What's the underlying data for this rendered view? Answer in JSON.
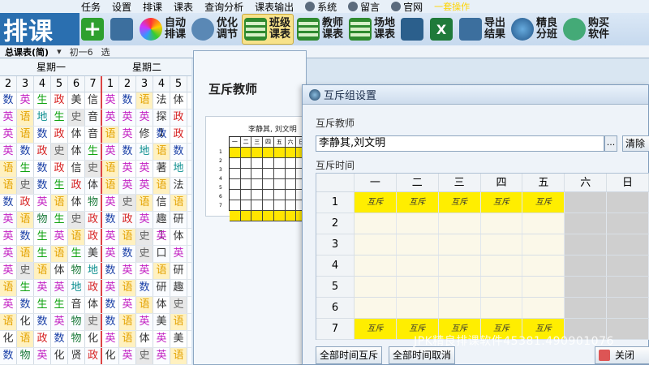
{
  "app": {
    "brand": "排课",
    "menu": [
      "任务",
      "设置",
      "排课",
      "课表",
      "查询分析",
      "课表输出"
    ],
    "menu_extra": [
      "系统",
      "留言",
      "官网"
    ],
    "menu_highlight": "一套操作"
  },
  "toolbar": [
    {
      "icon": "plus-icon",
      "label": ""
    },
    {
      "icon": "import-icon",
      "label": ""
    },
    {
      "icon": "auto-schedule-icon",
      "label": "自动排课"
    },
    {
      "icon": "optimize-icon",
      "label": "优化调节"
    },
    {
      "icon": "class-table-icon",
      "label": "班级课表",
      "active": true
    },
    {
      "icon": "teacher-table-icon",
      "label": "教师课表"
    },
    {
      "icon": "venue-table-icon",
      "label": "场地课表"
    },
    {
      "icon": "save-icon",
      "label": ""
    },
    {
      "icon": "excel-icon",
      "label": ""
    },
    {
      "icon": "export-icon",
      "label": "导出结果"
    },
    {
      "icon": "globe-icon",
      "label": "精良分班"
    },
    {
      "icon": "buy-icon",
      "label": "购买软件"
    }
  ],
  "subbar": {
    "view": "总课表(简)",
    "term": "初一6",
    "option": "选"
  },
  "grid": {
    "days": [
      "星期一",
      "星期二"
    ],
    "periods": [
      "2",
      "3",
      "4",
      "5",
      "6",
      "7",
      "1",
      "2",
      "3",
      "4",
      "5"
    ],
    "rows": [
      [
        "数",
        "英",
        "生",
        "政",
        "美",
        "信",
        "英",
        "数",
        "语",
        "法",
        "体"
      ],
      [
        "英",
        "语",
        "地",
        "生",
        "史",
        "音",
        "英",
        "英",
        "英",
        "探1",
        "政"
      ],
      [
        "英",
        "语",
        "数",
        "政",
        "体",
        "音",
        "语",
        "英",
        "修",
        "数",
        "政"
      ],
      [
        "英",
        "数",
        "政",
        "史",
        "体",
        "生",
        "英",
        "数",
        "地",
        "语",
        "数"
      ],
      [
        "语",
        "生",
        "数",
        "政",
        "信",
        "史",
        "语",
        "英",
        "英",
        "著",
        "地"
      ],
      [
        "语",
        "史",
        "数",
        "生",
        "政",
        "体",
        "语",
        "英",
        "英",
        "语",
        "法"
      ],
      [
        "数",
        "政",
        "英",
        "语",
        "体",
        "物",
        "英",
        "史",
        "语",
        "信",
        "语"
      ],
      [
        "英",
        "语",
        "物",
        "生",
        "史",
        "政",
        "数",
        "政",
        "英",
        "趣1",
        "研"
      ],
      [
        "英",
        "数",
        "生",
        "英",
        "语",
        "政",
        "英",
        "语",
        "史",
        "英",
        "体"
      ],
      [
        "英",
        "语",
        "生",
        "语",
        "生",
        "美",
        "英",
        "数",
        "史",
        "口1",
        "英"
      ],
      [
        "英",
        "史",
        "语",
        "体",
        "物",
        "地",
        "数",
        "英",
        "英",
        "语",
        "研"
      ],
      [
        "语",
        "生",
        "英",
        "英",
        "地",
        "政",
        "英",
        "语",
        "数",
        "研",
        "趣1"
      ],
      [
        "英",
        "数",
        "生",
        "生",
        "音",
        "体",
        "数",
        "英",
        "语",
        "体",
        "史"
      ],
      [
        "语",
        "化",
        "数",
        "英",
        "物",
        "史",
        "数",
        "语",
        "英",
        "美",
        "语"
      ],
      [
        "化",
        "语",
        "政",
        "数",
        "物",
        "化",
        "英",
        "语",
        "体",
        "英",
        "美"
      ],
      [
        "数",
        "物",
        "英",
        "化",
        "贤",
        "政",
        "化",
        "英",
        "史",
        "英",
        "语"
      ]
    ]
  },
  "mid": {
    "title": "互斥教师",
    "mini_name": "李静其, 刘文明",
    "mini_cols": [
      "一",
      "二",
      "三",
      "四",
      "五",
      "六",
      "日"
    ],
    "mini_rows": [
      "1",
      "2",
      "3",
      "4",
      "5",
      "6",
      "7"
    ]
  },
  "dialog": {
    "title": "互斥组设置",
    "teacher_label": "互斥教师",
    "teacher_value": "李静其,刘文明",
    "ellipsis": "...",
    "clear": "清除",
    "time_label": "互斥时间",
    "days": [
      "一",
      "二",
      "三",
      "四",
      "五",
      "六",
      "日"
    ],
    "mark": "互斥",
    "rows": [
      {
        "num": "1",
        "slots": [
          true,
          true,
          true,
          true,
          true,
          false,
          false
        ]
      },
      {
        "num": "2",
        "slots": [
          false,
          false,
          false,
          false,
          false,
          false,
          false
        ]
      },
      {
        "num": "3",
        "slots": [
          false,
          false,
          false,
          false,
          false,
          false,
          false
        ]
      },
      {
        "num": "4",
        "slots": [
          false,
          false,
          false,
          false,
          false,
          false,
          false
        ]
      },
      {
        "num": "5",
        "slots": [
          false,
          false,
          false,
          false,
          false,
          false,
          false
        ]
      },
      {
        "num": "6",
        "slots": [
          false,
          false,
          false,
          false,
          false,
          false,
          false
        ]
      },
      {
        "num": "7",
        "slots": [
          true,
          true,
          true,
          true,
          true,
          false,
          false
        ]
      }
    ],
    "btn_all": "全部时间互斥",
    "btn_cancel": "全部时间取消",
    "btn_close": "关闭"
  },
  "watermark": "JPK精良排课软件45381.490901076"
}
